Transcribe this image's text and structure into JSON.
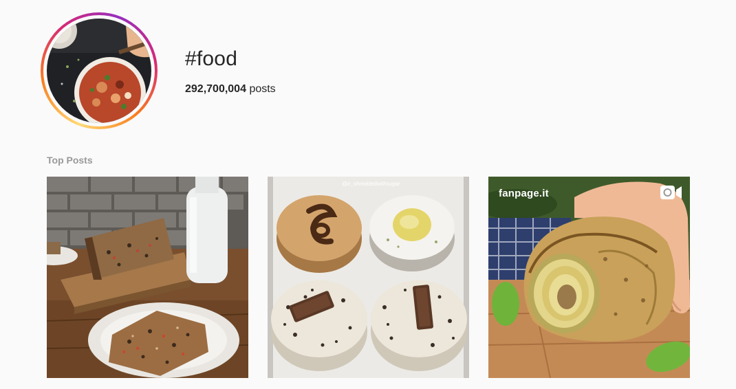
{
  "header": {
    "hashtag": "#food",
    "post_count": "292,700,004",
    "post_count_unit": "posts"
  },
  "sections": {
    "top_posts_label": "Top Posts"
  },
  "top_posts": [
    {
      "overlay_text": ""
    },
    {
      "overlay_text": "@ir_shreddedwithsugar"
    },
    {
      "overlay_text": "fanpage.it",
      "media_type": "video-icon"
    }
  ],
  "colors": {
    "background": "#fafafa",
    "ring_gradient": [
      "#feda75",
      "#fa7e1e",
      "#d62976",
      "#962fbf"
    ],
    "section_heading": "#999999"
  }
}
